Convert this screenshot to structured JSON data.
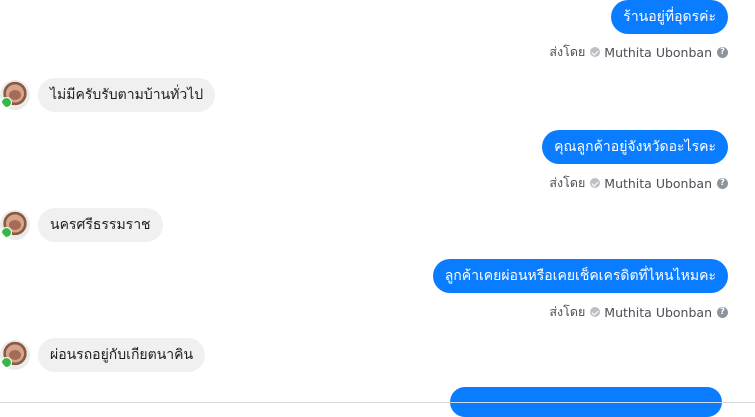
{
  "colors": {
    "outgoing_bubble": "#0a7cff",
    "incoming_bubble": "#f1f0f0",
    "meta_text": "#4b4f56"
  },
  "messages": [
    {
      "direction": "outgoing",
      "text": "ร้านอยู่ที่อุดรค่ะ",
      "sent_by_label": "ส่งโดย",
      "sender_name": "Muthita Ubonban"
    },
    {
      "direction": "incoming",
      "text": "ไม่มีครับรับตามบ้านทั่วไป",
      "avatar_icon": "user-avatar"
    },
    {
      "direction": "outgoing",
      "text": "คุณลูกค้าอยู่จังหวัดอะไรคะ",
      "sent_by_label": "ส่งโดย",
      "sender_name": "Muthita Ubonban"
    },
    {
      "direction": "incoming",
      "text": "นครศรีธรรมราช",
      "avatar_icon": "user-avatar"
    },
    {
      "direction": "outgoing",
      "text": "ลูกค้าเคยผ่อนหรือเคยเช็คเครดิตที่ไหนไหมคะ",
      "sent_by_label": "ส่งโดย",
      "sender_name": "Muthita Ubonban"
    },
    {
      "direction": "incoming",
      "text": "ผ่อนรถอยู่กับเกียตนาคิน",
      "avatar_icon": "user-avatar"
    }
  ]
}
